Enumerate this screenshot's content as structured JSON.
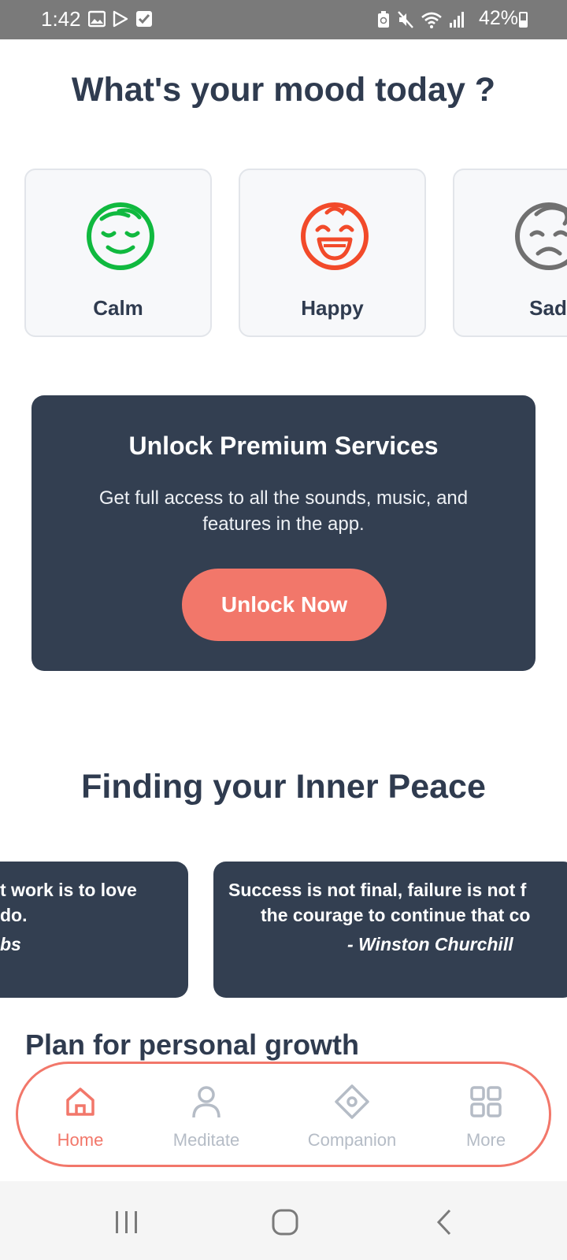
{
  "status_bar": {
    "time": "1:42",
    "battery": "42%"
  },
  "mood_section": {
    "title": "What's your mood today ?",
    "moods": [
      {
        "label": "Calm",
        "icon": "calm-face-icon",
        "color": "#10b93f"
      },
      {
        "label": "Happy",
        "icon": "happy-face-icon",
        "color": "#f24a2a"
      },
      {
        "label": "Sad",
        "icon": "sad-face-icon",
        "color": "#707070"
      }
    ]
  },
  "premium": {
    "title": "Unlock Premium Services",
    "description": "Get full access to all the sounds, music, and features in the app.",
    "button": "Unlock Now"
  },
  "peace_section": {
    "title": "Finding your Inner Peace",
    "quotes": [
      {
        "line1": "t work is to love",
        "line2": "do.",
        "author": "bs"
      },
      {
        "line1": "Success is not final, failure is not f",
        "line2": "the courage to continue that co",
        "author": "- Winston Churchill"
      }
    ]
  },
  "growth_section": {
    "title": "Plan for personal growth"
  },
  "bottom_nav": {
    "items": [
      {
        "label": "Home",
        "icon": "home-icon",
        "active": true
      },
      {
        "label": "Meditate",
        "icon": "person-icon",
        "active": false
      },
      {
        "label": "Companion",
        "icon": "diamond-icon",
        "active": false
      },
      {
        "label": "More",
        "icon": "grid-icon",
        "active": false
      }
    ]
  },
  "colors": {
    "accent": "#f2776a",
    "dark": "#333f51",
    "title": "#2f3b4f",
    "inactive": "#b5bcc6"
  }
}
